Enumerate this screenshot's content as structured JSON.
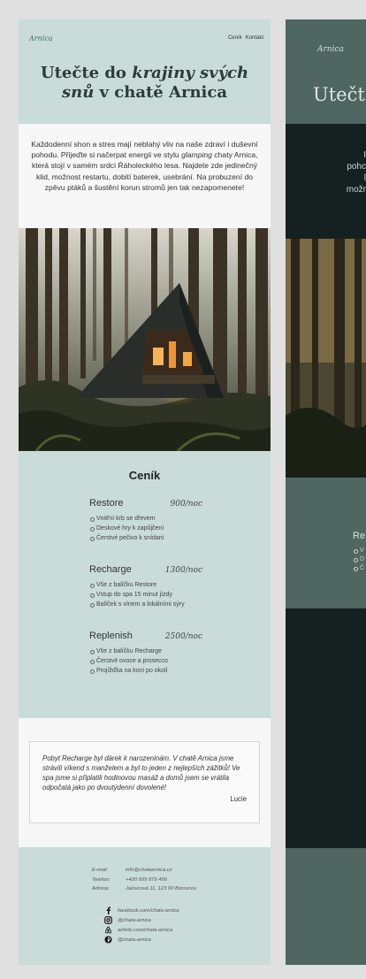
{
  "site": {
    "logo": "Arnica",
    "nav": [
      "Ceník",
      "Kontakt"
    ],
    "title_prefix": "Utečte do ",
    "title_em": "krajiny svých snů",
    "title_suffix": " v chatě Arnica",
    "intro_part1": "Každodenní shon a stres mají neblahý vliv na naše zdraví i duševní pohodu. Přijeďte si načerpat energii ve stylu ",
    "intro_em": "glamping",
    "intro_part2": " chaty Arnica, která stojí v samém srdci Ŕáholeckého lesa. Najdete zde jedinečný klid, možnost restartu, dobití baterek, usebrání. Na probuzení do zpěvu ptáků a šustění korun stromů jen tak nezapomenete!"
  },
  "pricing": {
    "heading": "Ceník",
    "plans": [
      {
        "name": "Restore",
        "price": "900/noc",
        "items": [
          "Vnitřní krb se dřevem",
          "Deskové hry k zapůjčení",
          "Čerstvé pečivo k snídani"
        ]
      },
      {
        "name": "Recharge",
        "price": "1300/noc",
        "items": [
          "Vše z balíčku Restore",
          "Vstup do spa 15 minut jízdy",
          "Balíček s vínem a lokálními sýry"
        ]
      },
      {
        "name": "Replenish",
        "price": "2500/noc",
        "items": [
          "Vše z balíčku Recharge",
          "Čerstvé ovoce a prosecco",
          "Projížďka na koni po okolí"
        ]
      }
    ]
  },
  "review": {
    "text": "Pobyt Recharge byl dárek k narozeninám. V chatě Arnica jsme strávili víkend s manželem a byl to jeden z nejlepších zážitků! Ve spa jsme si připlatili hodinovou masáž a domů jsem se vrátila odpočatá jako po dvoutýdenní dovolené!",
    "author": "Lucie"
  },
  "footer": {
    "contact": [
      {
        "label": "E-mail:",
        "value": "info@chataarnica.cz"
      },
      {
        "label": "Telefon:",
        "value": "+420 605 879 456"
      },
      {
        "label": "Adresa:",
        "value": "Jalovcová 11, 123 00 Borovcov"
      }
    ],
    "social": [
      {
        "icon": "facebook-icon",
        "text": "facebook.com/chata-arnica"
      },
      {
        "icon": "instagram-icon",
        "text": "@chata-arnica"
      },
      {
        "icon": "airbnb-icon",
        "text": "airbnb.com/chata-arnica"
      },
      {
        "icon": "pinterest-icon",
        "text": "@chata-arnica"
      }
    ]
  },
  "dark_preview": {
    "logo": "Arnica",
    "title": "Utečt",
    "intro_fragments": [
      "I",
      "pohc",
      "l",
      "možr"
    ],
    "plan_name": "Re",
    "items": [
      "V",
      "D",
      "Č"
    ]
  },
  "colors": {
    "light_accent": "#c9dcd8",
    "dark_accent": "#4f6661",
    "dark_bg": "#152120"
  }
}
